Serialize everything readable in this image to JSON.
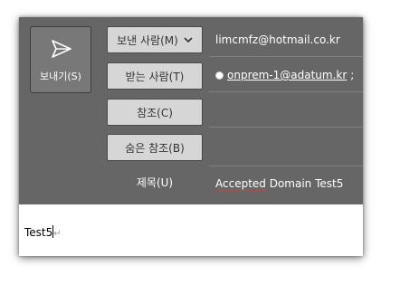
{
  "compose": {
    "send_label": "보내기(S)",
    "from_button": "보낸 사람(M)",
    "to_button": "받는 사람(T)",
    "cc_button": "참조(C)",
    "bcc_button": "숨은 참조(B)",
    "subject_label": "제목(U)",
    "from_value": "limcmfz@hotmail.co.kr",
    "to_recipient": "onprem-1@adatum.kr",
    "to_separator": ";",
    "cc_value": "",
    "bcc_value": "",
    "subject_word": "Accepted",
    "subject_rest": " Domain Test5",
    "body_text": "Test5",
    "paragraph_mark": "↵"
  },
  "icons": {
    "send": "send-paper-plane-icon",
    "from_dropdown": "chevron-down-icon",
    "presence": "presence-status-icon"
  },
  "colors": {
    "header_bg": "#666666",
    "button_bg": "#d6d6d6",
    "send_button_bg": "#787878",
    "spelling_underline": "#d04040"
  }
}
